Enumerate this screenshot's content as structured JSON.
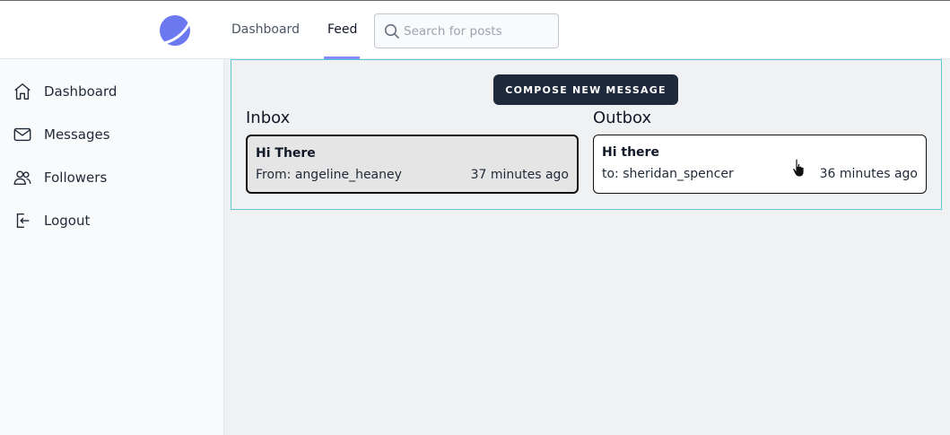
{
  "header": {
    "nav": [
      {
        "label": "Dashboard",
        "active": false
      },
      {
        "label": "Feed",
        "active": true
      }
    ],
    "search": {
      "placeholder": "Search for posts",
      "value": ""
    }
  },
  "sidebar": {
    "items": [
      {
        "label": "Dashboard",
        "icon": "home-icon"
      },
      {
        "label": "Messages",
        "icon": "mail-icon"
      },
      {
        "label": "Followers",
        "icon": "users-icon"
      },
      {
        "label": "Logout",
        "icon": "logout-icon"
      }
    ]
  },
  "main": {
    "compose_label": "COMPOSE NEW MESSAGE",
    "inbox": {
      "title": "Inbox",
      "messages": [
        {
          "subject": "Hi There",
          "from": "From: angeline_heaney",
          "time": "37 minutes ago"
        }
      ]
    },
    "outbox": {
      "title": "Outbox",
      "messages": [
        {
          "subject": "Hi there",
          "to": "to: sheridan_spencer",
          "time": "36 minutes ago"
        }
      ]
    }
  },
  "colors": {
    "accent": "#818cf8",
    "compose_bg": "#1e293b",
    "panel_border": "#5ec8d6",
    "logo": "#6b78f0"
  }
}
